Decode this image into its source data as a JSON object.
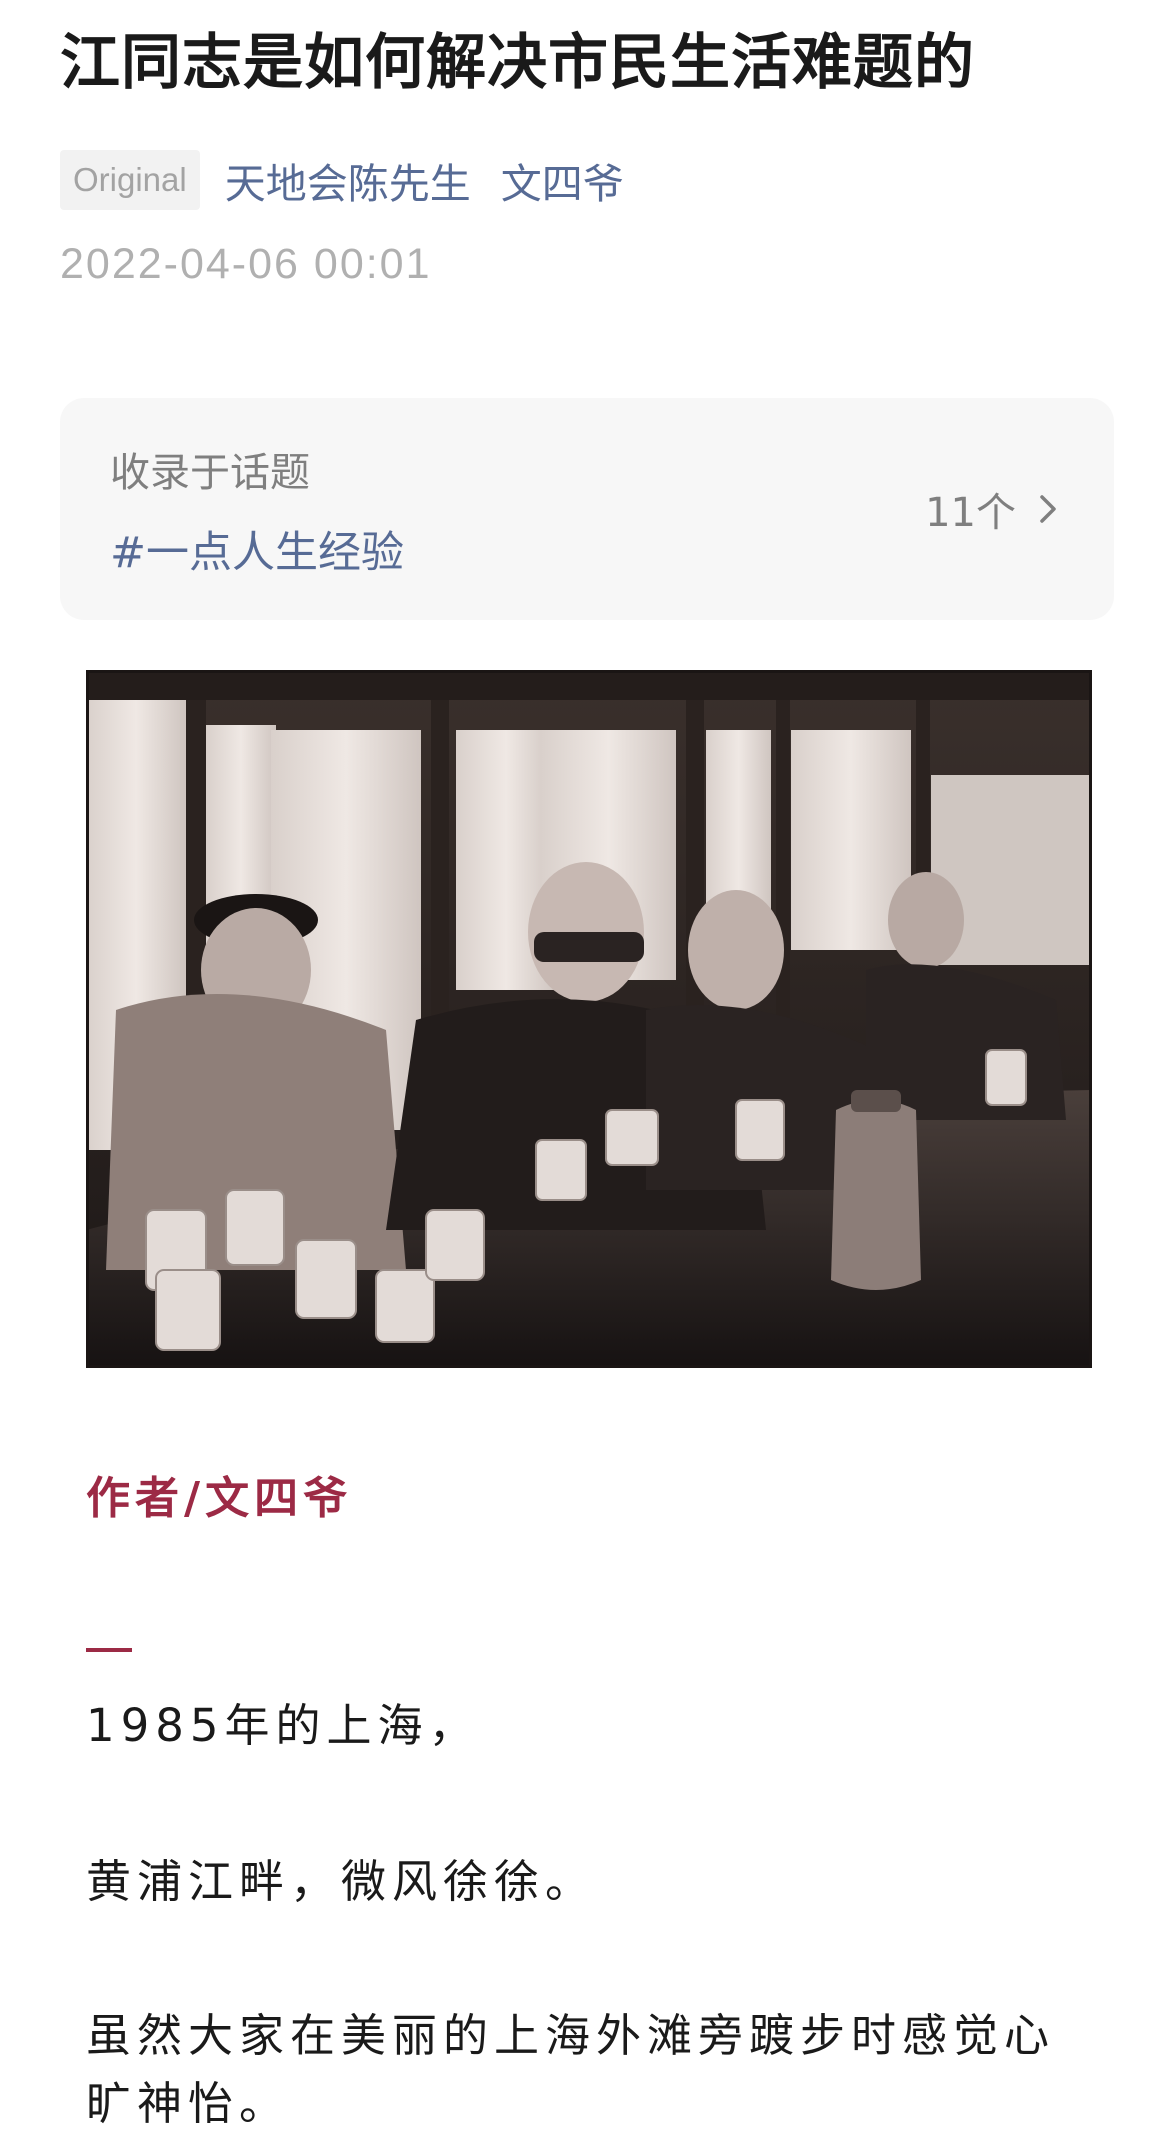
{
  "article": {
    "title": "江同志是如何解决市民生活难题的",
    "badge": "Original",
    "account": "天地会陈先生",
    "author": "文四爷",
    "date": "2022-04-06 00:01"
  },
  "topic": {
    "label": "收录于话题",
    "tag": "#一点人生经验",
    "count": "11个"
  },
  "photo": {
    "description_icon": "photo"
  },
  "content": {
    "byline": "作者/文四爷",
    "paragraphs": [
      "1985年的上海，",
      "黄浦江畔，微风徐徐。",
      "虽然大家在美丽的上海外滩旁踱步时感觉心旷神怡。"
    ]
  },
  "colors": {
    "link": "#576b95",
    "accent": "#9c2a45"
  }
}
